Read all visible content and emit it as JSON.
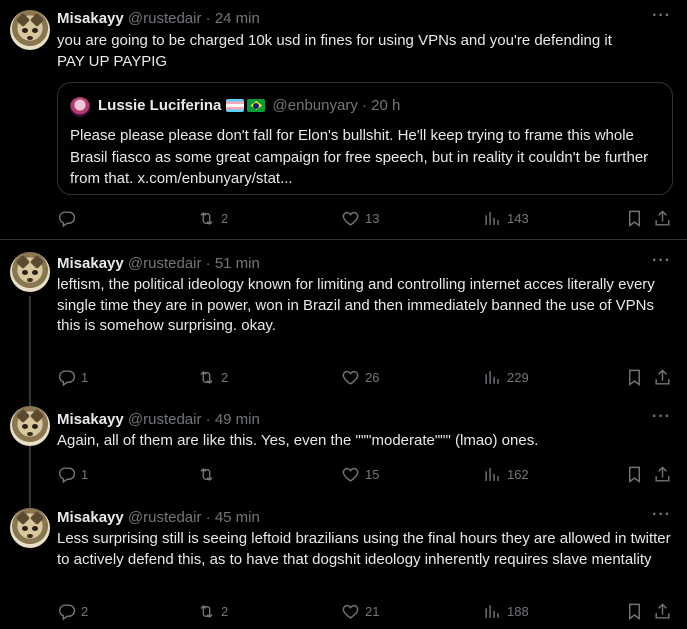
{
  "tweets": [
    {
      "name": "Misakayy",
      "handle": "@rustedair",
      "time": "24 min",
      "more": "···",
      "text": "you are going to be charged 10k usd in fines for using VPNs and you're defending it\nPAY UP PAYPIG",
      "quote": {
        "name": "Lussie Luciferina",
        "handle": "@enbunyary",
        "time": "20 h",
        "text": "Please please please don't fall for Elon's bullshit. He'll keep trying to frame this whole Brasil fiasco as some great campaign for free speech, but in reality it couldn't be further from that. x.com/enbunyary/stat..."
      },
      "replies": "",
      "reposts": "2",
      "likes": "13",
      "views": "143"
    },
    {
      "name": "Misakayy",
      "handle": "@rustedair",
      "time": "51 min",
      "more": "···",
      "text": "leftism, the political ideology known for limiting and controlling internet acces literally every single time they are in power, won in Brazil and then immediately banned the use of VPNs\nthis is somehow surprising. okay.",
      "replies": "1",
      "reposts": "2",
      "likes": "26",
      "views": "229"
    },
    {
      "name": "Misakayy",
      "handle": "@rustedair",
      "time": "49 min",
      "more": "···",
      "text": "Again, all of them are like this. Yes, even the \"\"\"moderate\"\"\" (lmao) ones.",
      "replies": "1",
      "reposts": "",
      "likes": "15",
      "views": "162"
    },
    {
      "name": "Misakayy",
      "handle": "@rustedair",
      "time": "45 min",
      "more": "···",
      "text": "Less surprising still is seeing leftoid brazilians using the final hours they are allowed in twitter to actively defend this, as to have that dogshit ideology inherently requires slave mentality",
      "replies": "2",
      "reposts": "2",
      "likes": "21",
      "views": "188"
    }
  ],
  "icons": {
    "reply": "reply-icon",
    "repost": "repost-icon",
    "like": "heart-icon",
    "views": "views-icon",
    "bookmark": "bookmark-icon",
    "share": "share-icon"
  },
  "colors": {
    "background": "#000000",
    "text": "#e7e9ea",
    "muted": "#71767b",
    "border": "#2f3336"
  }
}
